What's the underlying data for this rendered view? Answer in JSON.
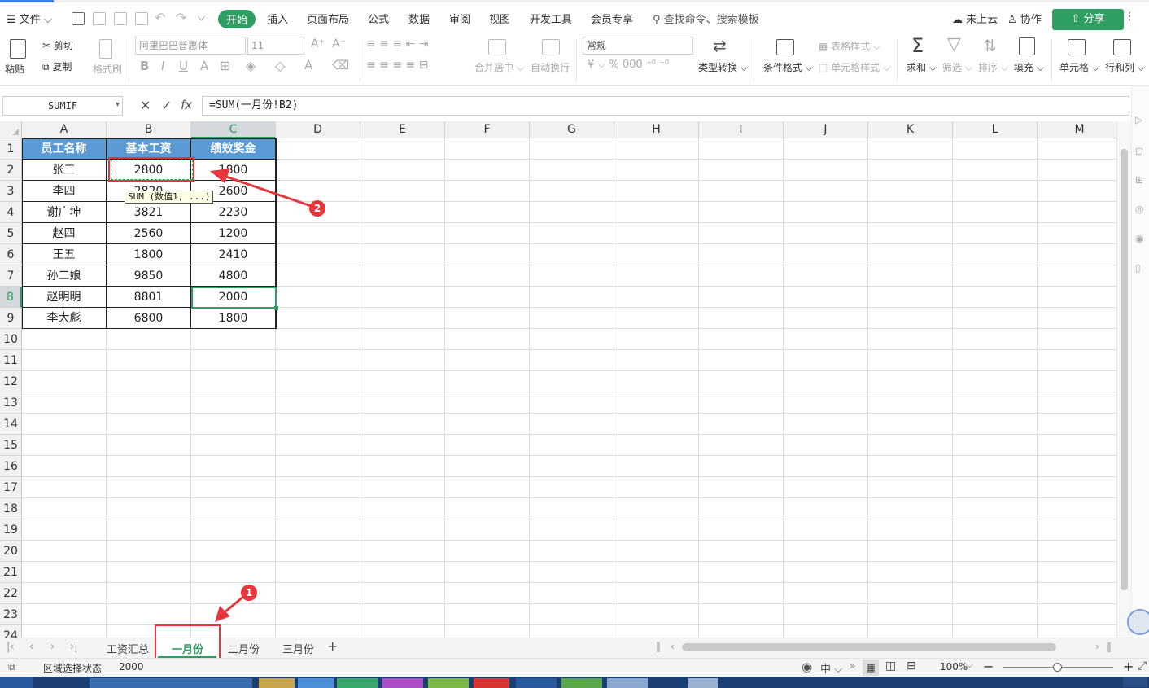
{
  "menu": {
    "file": "文件",
    "tabs": [
      "开始",
      "插入",
      "页面布局",
      "公式",
      "数据",
      "审阅",
      "视图",
      "开发工具",
      "会员专享"
    ],
    "active_tab": "开始",
    "search_placeholder": "查找命令、搜索模板",
    "cloud": "未上云",
    "collab": "协作",
    "share": "分享"
  },
  "ribbon": {
    "paste": "粘贴",
    "cut": "剪切",
    "copy": "复制",
    "format_painter": "格式刷",
    "font_name": "阿里巴巴普惠体",
    "font_size": "11",
    "merge_center": "合并居中",
    "wrap_text": "自动换行",
    "number_format": "常规",
    "convert": "类型转换",
    "cond_format": "条件格式",
    "table_style": "表格样式",
    "cell_style": "单元格样式",
    "sum": "求和",
    "filter": "筛选",
    "sort": "排序",
    "fill": "填充",
    "cell": "单元格",
    "rowcol": "行和列"
  },
  "formula_bar": {
    "name_box": "SUMIF",
    "fx": "fx",
    "formula": "=SUM(一月份!B2)"
  },
  "grid": {
    "columns": [
      "A",
      "B",
      "C",
      "D",
      "E",
      "F",
      "G",
      "H",
      "I",
      "J",
      "K",
      "L",
      "M"
    ],
    "rows": [
      "1",
      "2",
      "3",
      "4",
      "5",
      "6",
      "7",
      "8",
      "9",
      "10",
      "11",
      "12",
      "13",
      "14",
      "15",
      "16",
      "17",
      "18",
      "19",
      "20",
      "21",
      "22",
      "23",
      "24"
    ],
    "headers": [
      "员工名称",
      "基本工资",
      "绩效奖金"
    ],
    "data": [
      [
        "张三",
        "2800",
        "1800"
      ],
      [
        "李四",
        "2820",
        "2600"
      ],
      [
        "谢广坤",
        "3821",
        "2230"
      ],
      [
        "赵四",
        "2560",
        "1200"
      ],
      [
        "王五",
        "1800",
        "2410"
      ],
      [
        "孙二娘",
        "9850",
        "4800"
      ],
      [
        "赵明明",
        "8801",
        "2000"
      ],
      [
        "李大彪",
        "6800",
        "1800"
      ]
    ],
    "tooltip": "SUM (数值1, ...)",
    "header_color": "#5b9bd5",
    "accent": "#2e9e63",
    "annotation_color": "#e8353b"
  },
  "callouts": [
    "1",
    "2"
  ],
  "sheets": {
    "tabs": [
      "工资汇总",
      "一月份",
      "二月份",
      "三月份"
    ],
    "active": "一月份",
    "add": "+"
  },
  "status": {
    "mode": "区域选择状态",
    "value": "2000",
    "zoom": "100%"
  }
}
